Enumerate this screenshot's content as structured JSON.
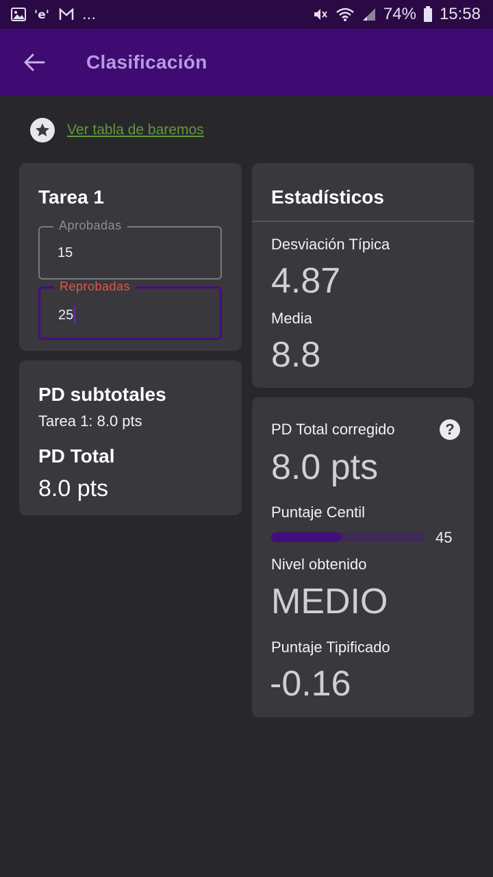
{
  "status_bar": {
    "left_icons": [
      "image-icon",
      "eset-icon",
      "gmail-icon"
    ],
    "more": "...",
    "battery": "74%",
    "time": "15:58",
    "right_icons": [
      "mute-icon",
      "wifi-icon",
      "signal-icon",
      "battery-icon"
    ]
  },
  "app_bar": {
    "title": "Clasificación",
    "back_icon": "arrow-back-icon",
    "color": "#3f0a72"
  },
  "link": {
    "label": "Ver tabla de baremos",
    "icon": "star-icon"
  },
  "tarea": {
    "title": "Tarea 1",
    "aprobadas": {
      "label": "Aprobadas",
      "value": "15"
    },
    "reprobadas": {
      "label": "Reprobadas",
      "value": "25"
    }
  },
  "pd": {
    "subtotales_title": "PD subtotales",
    "subtotal_line": "Tarea 1: 8.0 pts",
    "total_title": "PD Total",
    "total_value": "8.0 pts"
  },
  "stats": {
    "title": "Estadísticos",
    "desviacion_label": "Desviación Típica",
    "desviacion_value": "4.87",
    "media_label": "Media",
    "media_value": "8.8"
  },
  "result": {
    "pd_corregido_label": "PD Total corregido",
    "pd_corregido_value": "8.0 pts",
    "help_icon": "help-icon",
    "centil_label": "Puntaje Centil",
    "centil_value": "45",
    "centil_fraction": 0.45,
    "nivel_label": "Nivel obtenido",
    "nivel_value": "MEDIO",
    "tipificado_label": "Puntaje Tipificado",
    "tipificado_value": "-0.16"
  }
}
